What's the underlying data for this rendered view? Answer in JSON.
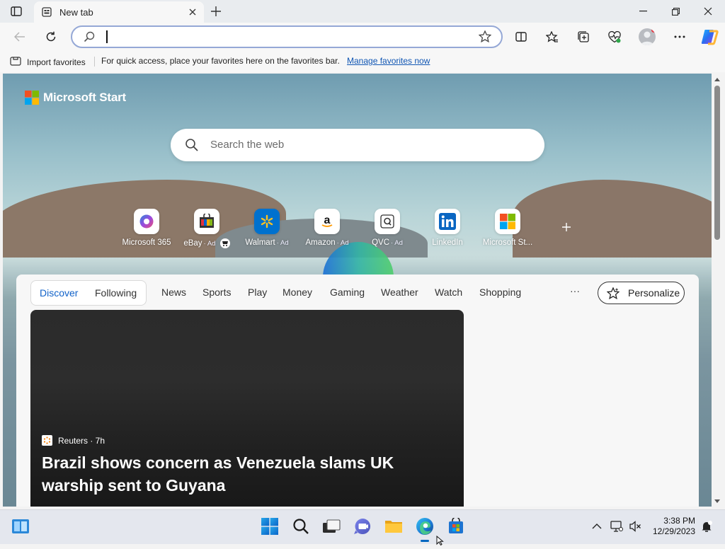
{
  "browser": {
    "tab_title": "New tab",
    "search_placeholder": "",
    "favorites_bar": {
      "import_label": "Import favorites",
      "message": "For quick access, place your favorites here on the favorites bar.",
      "manage_link": "Manage favorites now"
    }
  },
  "page": {
    "brand": "Microsoft Start",
    "search_placeholder": "Search the web",
    "quick_links": [
      {
        "label": "Microsoft 365",
        "ad": ""
      },
      {
        "label": "eBay",
        "ad": "· Ad"
      },
      {
        "label": "Walmart",
        "ad": "· Ad"
      },
      {
        "label": "Amazon",
        "ad": "· Ad"
      },
      {
        "label": "QVC",
        "ad": "· Ad"
      },
      {
        "label": "LinkedIn",
        "ad": ""
      },
      {
        "label": "Microsoft St...",
        "ad": ""
      }
    ],
    "feed_tabs": {
      "discover": "Discover",
      "following": "Following",
      "categories": [
        "News",
        "Sports",
        "Play",
        "Money",
        "Gaming",
        "Weather",
        "Watch",
        "Shopping"
      ],
      "more": "···",
      "personalize": "Personalize"
    },
    "headline_card": {
      "source": "Reuters · 7h",
      "title": "Brazil shows concern as Venezuela slams UK warship sent to Guyana"
    }
  },
  "taskbar": {
    "time": "3:38 PM",
    "date": "12/29/2023"
  },
  "colors": {
    "accent": "#0f55b3",
    "address_border": "#95a8d6",
    "taskbar": "#e4e7ee"
  }
}
